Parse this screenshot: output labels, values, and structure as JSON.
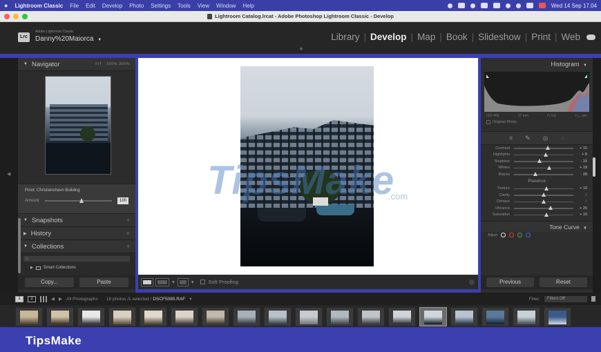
{
  "menubar": {
    "app": "Lightroom Classic",
    "items": [
      "File",
      "Edit",
      "Develop",
      "Photo",
      "Settings",
      "Tools",
      "View",
      "Window",
      "Help"
    ],
    "datetime": "Wed 14 Sep  17.04"
  },
  "window": {
    "title": "Lightroom Catalog.lrcat - Adobe Photoshop Lightroom Classic - Develop"
  },
  "header": {
    "logo": "Lrc",
    "subtitle": "Adobe Lightroom Classic",
    "user": "Danny%20Maiorca",
    "user_caret": "▼",
    "modules": [
      "Library",
      "Develop",
      "Map",
      "Book",
      "Slideshow",
      "Print",
      "Web"
    ],
    "active_module": "Develop"
  },
  "left_panel": {
    "navigator": {
      "label": "Navigator",
      "zoom_options": "FIT :  100%  300%"
    },
    "pin": {
      "label": "Pinot: Christianshavn Building",
      "amount_label": "Amount",
      "amount_value": "100",
      "amount_fraction": 1.0
    },
    "snapshots": {
      "label": "Snapshots"
    },
    "history": {
      "label": "History"
    },
    "collections": {
      "label": "Collections",
      "search_placeholder": "Q",
      "smart": "Smart Collections"
    },
    "copy": "Copy...",
    "paste": "Paste"
  },
  "center": {
    "watermark": "TipsMake",
    "watermark_suffix": ".com",
    "toolbar": {
      "soft_proofing": "Soft Proofing"
    }
  },
  "right_panel": {
    "histogram": {
      "label": "Histogram",
      "iso": "ISO 400",
      "focal": "27 mm",
      "aperture": "f / 5,6",
      "shutter": "¹⁄₂₅₀ sec",
      "original_photo": "Original Photo"
    },
    "adjustments": [
      {
        "label": "Contrast",
        "value": "+ 15",
        "pos": 0.57
      },
      {
        "label": "Highlights",
        "value": "+ 8",
        "pos": 0.54
      },
      {
        "label": "Shadows",
        "value": "- 15",
        "pos": 0.43
      },
      {
        "label": "Whites",
        "value": "+ 19",
        "pos": 0.59
      },
      {
        "label": "Blacks",
        "value": "- 28",
        "pos": 0.36
      }
    ],
    "presence_label": "Presence",
    "presence": [
      {
        "label": "Texture",
        "value": "+ 10",
        "pos": 0.55,
        "zero": false
      },
      {
        "label": "Clarity",
        "value": "0",
        "pos": 0.5,
        "zero": true
      },
      {
        "label": "Dehaze",
        "value": "0",
        "pos": 0.5,
        "zero": true
      },
      {
        "label": "Vibrance",
        "value": "+ 25",
        "pos": 0.62,
        "zero": false
      },
      {
        "label": "Saturation",
        "value": "+ 10",
        "pos": 0.55,
        "zero": false
      }
    ],
    "tone_curve": {
      "label": "Tone Curve",
      "adjust": "Adjust"
    },
    "previous": "Previous",
    "reset": "Reset"
  },
  "filmstrip_bar": {
    "box1": "1",
    "box2": "2",
    "source": "All Photographs",
    "count": "18 photos /1 selected /",
    "filename": "DSCF5085.RAF",
    "filter_label": "Filter:",
    "filter_value": "Filters Off"
  },
  "filmstrip": {
    "thumbs": [
      {
        "colors": [
          "#c8b89a",
          "#4a3a2c"
        ]
      },
      {
        "colors": [
          "#d0c2a8",
          "#3a2a20"
        ]
      },
      {
        "colors": [
          "#e8e8e8",
          "#2a2a2a"
        ]
      },
      {
        "colors": [
          "#d8d0c0",
          "#5a4a3a"
        ]
      },
      {
        "colors": [
          "#e0d8c8",
          "#4a3a30"
        ]
      },
      {
        "colors": [
          "#dcd4c8",
          "#3a3030"
        ]
      },
      {
        "colors": [
          "#c0b8a8",
          "#3a3028"
        ]
      },
      {
        "colors": [
          "#a8b0b8",
          "#2a3038"
        ]
      },
      {
        "colors": [
          "#b8c0c8",
          "#303840"
        ]
      },
      {
        "colors": [
          "#c8ccd0",
          "#707478"
        ]
      },
      {
        "colors": [
          "#b0b8c0",
          "#3a4048"
        ]
      },
      {
        "colors": [
          "#c0c4c8",
          "#303438"
        ]
      },
      {
        "colors": [
          "#d0d4d8",
          "#202428"
        ]
      },
      {
        "colors": [
          "#cfd6de",
          "#0e1319"
        ]
      },
      {
        "colors": [
          "#b8c4d0",
          "#203040"
        ]
      },
      {
        "colors": [
          "#5a7a9a",
          "#102030"
        ]
      },
      {
        "colors": [
          "#c8d0d8",
          "#404850"
        ]
      },
      {
        "colors": [
          "#3a5a8a",
          "#d0d8e8"
        ]
      }
    ],
    "selected_index": 13
  },
  "brand": {
    "name": "TipsMake"
  }
}
